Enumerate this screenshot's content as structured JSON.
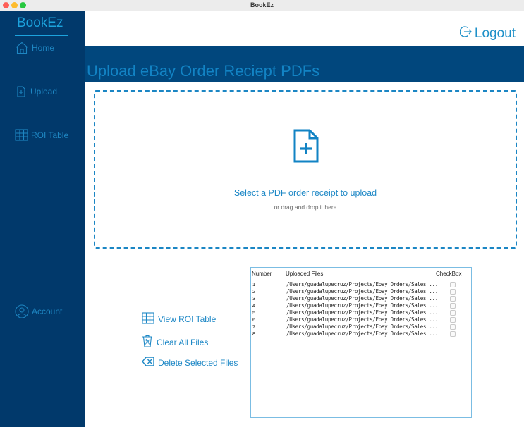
{
  "window": {
    "title": "BookEz"
  },
  "sidebar": {
    "brand": "BookEz",
    "items": [
      {
        "label": "Home",
        "icon": "home-icon"
      },
      {
        "label": "Upload",
        "icon": "upload-icon"
      },
      {
        "label": "ROI Table",
        "icon": "table-icon"
      },
      {
        "label": "Account",
        "icon": "account-icon"
      }
    ]
  },
  "header": {
    "logout_label": "Logout"
  },
  "main": {
    "title": "Upload eBay Order Reciept PDFs",
    "dropzone": {
      "main_text": "Select a PDF order receipt to upload",
      "sub_text": "or drag and drop it here"
    },
    "actions": {
      "view_roi": "View ROI Table",
      "clear_all": "Clear All Files",
      "delete_selected": "Delete Selected Files"
    },
    "table": {
      "headers": {
        "number": "Number",
        "files": "Uploaded Files",
        "checkbox": "CheckBox"
      },
      "rows": [
        {
          "number": "1",
          "file": "/Users/guadalupecruz/Projects/Ebay Orders/Sales ..."
        },
        {
          "number": "2",
          "file": "/Users/guadalupecruz/Projects/Ebay Orders/Sales ..."
        },
        {
          "number": "3",
          "file": "/Users/guadalupecruz/Projects/Ebay Orders/Sales ..."
        },
        {
          "number": "4",
          "file": "/Users/guadalupecruz/Projects/Ebay Orders/Sales ..."
        },
        {
          "number": "5",
          "file": "/Users/guadalupecruz/Projects/Ebay Orders/Sales ..."
        },
        {
          "number": "6",
          "file": "/Users/guadalupecruz/Projects/Ebay Orders/Sales ..."
        },
        {
          "number": "7",
          "file": "/Users/guadalupecruz/Projects/Ebay Orders/Sales ..."
        },
        {
          "number": "8",
          "file": "/Users/guadalupecruz/Projects/Ebay Orders/Sales ..."
        }
      ]
    }
  },
  "colors": {
    "sidebar": "#01396b",
    "banner": "#01477d",
    "accent": "#1e88c6",
    "brand": "#1ca3dd"
  }
}
